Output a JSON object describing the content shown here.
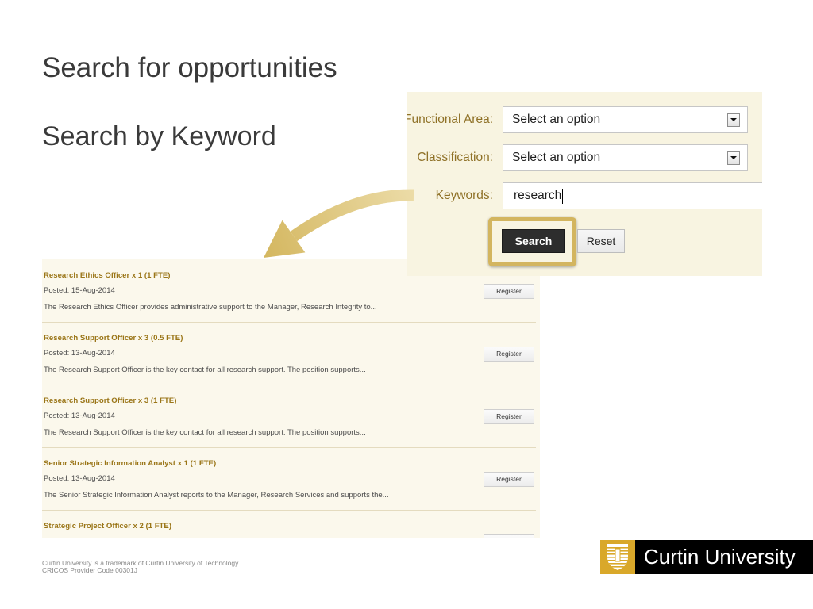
{
  "slide": {
    "title": "Search for opportunities",
    "subtitle": "Search by Keyword"
  },
  "search_form": {
    "functional_area": {
      "label": "Functional Area:",
      "value": "Select an option"
    },
    "classification": {
      "label": "Classification:",
      "value": "Select an option"
    },
    "keywords": {
      "label": "Keywords:",
      "value": "research"
    },
    "search_button": "Search",
    "reset_button": "Reset"
  },
  "results": [
    {
      "title": "Research Ethics Officer x 1 (1 FTE)",
      "posted": "Posted: 15-Aug-2014",
      "description": "The Research Ethics Officer provides administrative support to the Manager, Research Integrity to...",
      "register_label": "Register"
    },
    {
      "title": "Research Support Officer x 3 (0.5 FTE)",
      "posted": "Posted: 13-Aug-2014",
      "description": "The Research Support Officer is the key contact for all research support. The position supports...",
      "register_label": "Register"
    },
    {
      "title": "Research Support Officer x 3 (1 FTE)",
      "posted": "Posted: 13-Aug-2014",
      "description": "The Research Support Officer is the key contact for all research support. The position supports...",
      "register_label": "Register"
    },
    {
      "title": "Senior Strategic Information Analyst x 1 (1 FTE)",
      "posted": "Posted: 13-Aug-2014",
      "description": "The Senior Strategic Information Analyst reports to the Manager, Research Services and supports the...",
      "register_label": "Register"
    },
    {
      "title": "Strategic Project Officer x 2 (1 FTE)"
    }
  ],
  "footer": {
    "trademark": "Curtin University is a trademark of Curtin University of Technology",
    "cricos": "CRICOS Provider Code 00301J"
  },
  "logo": {
    "wordmark": "Curtin University",
    "crest_icon": "shield-crest-icon"
  },
  "icons": {
    "dropdown": "dropdown-arrow-icon",
    "pointer_arrow": "curved-arrow-icon"
  },
  "colors": {
    "text": "#3a3a3a",
    "label_gold": "#8f7127",
    "result_title": "#9a7517",
    "panel_bg": "#f8f4e1",
    "results_bg": "#fbf8ec",
    "highlight": "#d3b55f",
    "search_button": "#2d2d2d",
    "logo_gold": "#d9a82a",
    "logo_black": "#000000"
  }
}
